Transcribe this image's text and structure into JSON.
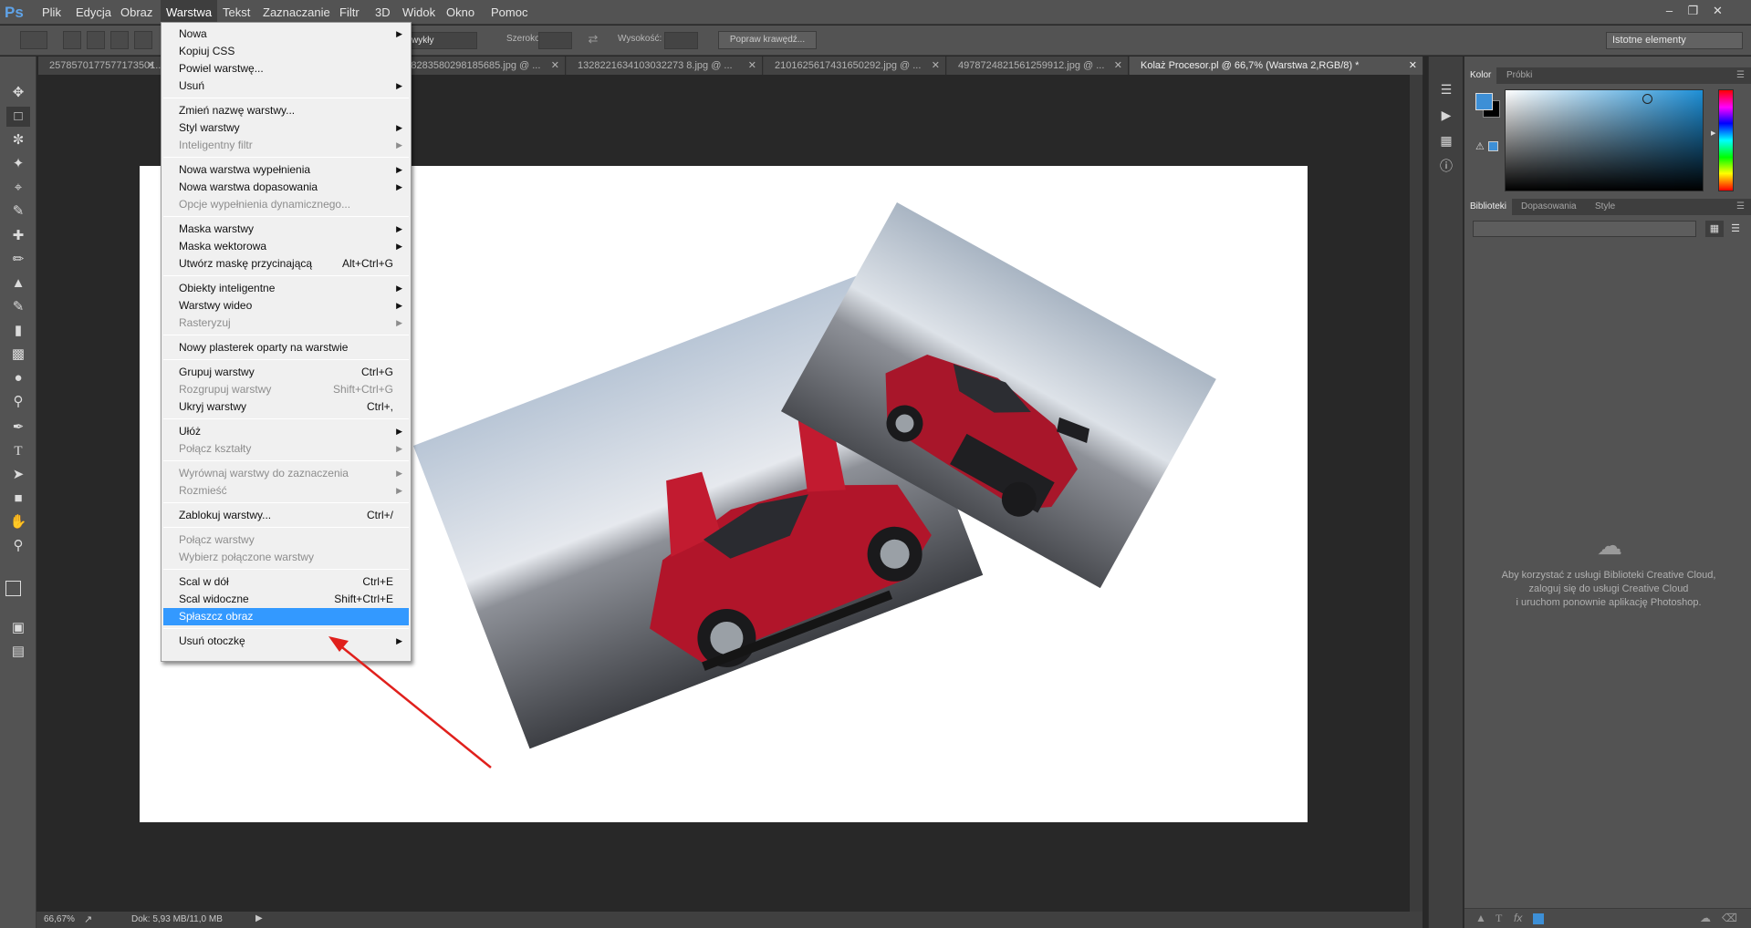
{
  "app": {
    "logo": "Ps"
  },
  "menubar": {
    "items": [
      "Plik",
      "Edycja",
      "Obraz",
      "Warstwa",
      "Tekst",
      "Zaznaczanie",
      "Filtr",
      "3D",
      "Widok",
      "Okno",
      "Pomoc"
    ],
    "active": "Warstwa",
    "window_controls": [
      "minimize-icon",
      "restore-icon",
      "close-icon"
    ]
  },
  "options_bar": {
    "style_value": "wykły",
    "width_label": "Szerokość:",
    "height_label": "Wysokość:",
    "refine_button": "Popraw krawędź...",
    "workspace": "Istotne elementy"
  },
  "tabs": [
    {
      "label": "2578570177577173501...",
      "active": false
    },
    {
      "label": "1218283580298185685.jpg @ ...",
      "active": false
    },
    {
      "label": "1328221634103032273 8.jpg @ ...",
      "active": false
    },
    {
      "label": "2101625617431650292.jpg @ ...",
      "active": false
    },
    {
      "label": "4978724821561259912.jpg @ ...",
      "active": false
    },
    {
      "label": "Kolaż Procesor.pl @ 66,7% (Warstwa 2,RGB/8) *",
      "active": true
    }
  ],
  "menu": {
    "items": [
      {
        "label": "Nowa",
        "submenu": true
      },
      {
        "label": "Kopiuj CSS"
      },
      {
        "label": "Powiel warstwę..."
      },
      {
        "label": "Usuń",
        "submenu": true
      },
      {
        "sep": true
      },
      {
        "label": "Zmień nazwę warstwy..."
      },
      {
        "label": "Styl warstwy",
        "submenu": true
      },
      {
        "label": "Inteligentny filtr",
        "submenu": true,
        "disabled": true
      },
      {
        "sep": true
      },
      {
        "label": "Nowa warstwa wypełnienia",
        "submenu": true
      },
      {
        "label": "Nowa warstwa dopasowania",
        "submenu": true
      },
      {
        "label": "Opcje wypełnienia dynamicznego...",
        "disabled": true
      },
      {
        "sep": true
      },
      {
        "label": "Maska warstwy",
        "submenu": true
      },
      {
        "label": "Maska wektorowa",
        "submenu": true
      },
      {
        "label": "Utwórz maskę przycinającą",
        "shortcut": "Alt+Ctrl+G"
      },
      {
        "sep": true
      },
      {
        "label": "Obiekty inteligentne",
        "submenu": true
      },
      {
        "label": "Warstwy wideo",
        "submenu": true
      },
      {
        "label": "Rasteryzuj",
        "submenu": true,
        "disabled": true
      },
      {
        "sep": true
      },
      {
        "label": "Nowy plasterek oparty na warstwie"
      },
      {
        "sep": true
      },
      {
        "label": "Grupuj warstwy",
        "shortcut": "Ctrl+G"
      },
      {
        "label": "Rozgrupuj warstwy",
        "shortcut": "Shift+Ctrl+G",
        "disabled": true
      },
      {
        "label": "Ukryj warstwy",
        "shortcut": "Ctrl+,"
      },
      {
        "sep": true
      },
      {
        "label": "Ułóż",
        "submenu": true
      },
      {
        "label": "Połącz kształty",
        "submenu": true,
        "disabled": true
      },
      {
        "sep": true
      },
      {
        "label": "Wyrównaj warstwy do zaznaczenia",
        "submenu": true,
        "disabled": true
      },
      {
        "label": "Rozmieść",
        "submenu": true,
        "disabled": true
      },
      {
        "sep": true
      },
      {
        "label": "Zablokuj warstwy...",
        "shortcut": "Ctrl+/"
      },
      {
        "sep": true
      },
      {
        "label": "Połącz warstwy",
        "disabled": true
      },
      {
        "label": "Wybierz połączone warstwy",
        "disabled": true
      },
      {
        "sep": true
      },
      {
        "label": "Scal w dół",
        "shortcut": "Ctrl+E"
      },
      {
        "label": "Scal widoczne",
        "shortcut": "Shift+Ctrl+E"
      },
      {
        "label": "Spłaszcz obraz",
        "highlighted": true
      },
      {
        "sep": true
      },
      {
        "label": "Usuń otoczkę",
        "submenu": true
      }
    ]
  },
  "panels": {
    "color_tabs": [
      "Kolor",
      "Próbki"
    ],
    "library_tabs": [
      "Biblioteki",
      "Dopasowania",
      "Style"
    ],
    "library_message": [
      "Aby korzystać z usługi Biblioteki Creative Cloud,",
      "zaloguj się do usługi Creative Cloud",
      "i uruchom ponownie aplikację Photoshop."
    ],
    "foreground_color": "#3d8fd6",
    "background_color": "#000000"
  },
  "status": {
    "zoom": "66,67%",
    "doc": "Dok: 5,93 MB/11,0 MB"
  },
  "colors": {
    "accent": "#3399ff",
    "annotation_arrow": "#e0201c"
  }
}
